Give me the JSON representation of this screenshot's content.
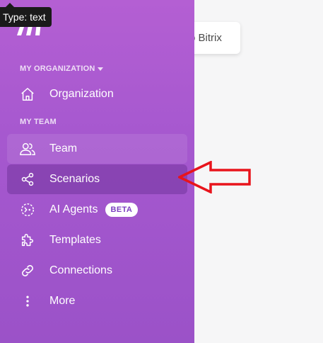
{
  "tooltip": {
    "text": "Type: text"
  },
  "background_card": {
    "text": "o Bitrix"
  },
  "sidebar": {
    "org_section_label": "MY ORGANIZATION",
    "team_section_label": "MY TEAM",
    "items": [
      {
        "label": "Organization",
        "icon": "home-icon"
      },
      {
        "label": "Team",
        "icon": "users-icon"
      },
      {
        "label": "Scenarios",
        "icon": "share-icon"
      },
      {
        "label": "AI Agents",
        "icon": "ai-agent-icon",
        "badge": "BETA"
      },
      {
        "label": "Templates",
        "icon": "puzzle-icon"
      },
      {
        "label": "Connections",
        "icon": "link-icon"
      },
      {
        "label": "More",
        "icon": "more-vertical-icon"
      }
    ]
  },
  "colors": {
    "sidebar_top": "#b45fd3",
    "sidebar_bottom": "#9b52c8",
    "annotation_arrow": "#e8141c",
    "badge_text": "#7b3fc0"
  }
}
